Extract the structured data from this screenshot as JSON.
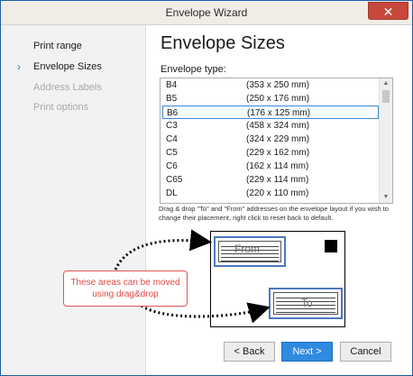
{
  "window": {
    "title": "Envelope Wizard",
    "close_glyph": "✕"
  },
  "sidebar": {
    "active_marker": "›",
    "items": [
      {
        "label": "Print range",
        "state": "normal"
      },
      {
        "label": "Envelope Sizes",
        "state": "active"
      },
      {
        "label": "Address Labels",
        "state": "disabled"
      },
      {
        "label": "Print options",
        "state": "disabled"
      }
    ]
  },
  "main": {
    "heading": "Envelope Sizes",
    "list_label": "Envelope type:",
    "envelopes": [
      {
        "name": "B4",
        "size": "(353 x 250 mm)"
      },
      {
        "name": "B5",
        "size": "(250 x 176 mm)"
      },
      {
        "name": "B6",
        "size": "(176 x 125 mm)",
        "selected": true
      },
      {
        "name": "C3",
        "size": "(458 x 324 mm)"
      },
      {
        "name": "C4",
        "size": "(324 x 229 mm)"
      },
      {
        "name": "C5",
        "size": "(229 x 162 mm)"
      },
      {
        "name": "C6",
        "size": "(162 x 114 mm)"
      },
      {
        "name": "C65",
        "size": "(229 x 114 mm)"
      },
      {
        "name": "DL",
        "size": "(220 x 110 mm)"
      }
    ],
    "hint": "Drag & drop \"To\" and \"From\" addresses on the envelope layout if you wish to change their placement, right click to reset back to default.",
    "from_label": "From",
    "to_label": "To",
    "callout": "These areas can be moved using drag&drop"
  },
  "buttons": {
    "back": "< Back",
    "next": "Next >",
    "cancel": "Cancel"
  },
  "colors": {
    "accent": "#2f8ae0",
    "address_box_border": "#4d77c4",
    "callout_red": "#e04848",
    "close_red": "#c7483d"
  },
  "icons": {
    "close": "close-icon",
    "chevron": "chevron-right-icon",
    "scroll_up": "scroll-up-icon",
    "scroll_down": "scroll-down-icon"
  }
}
